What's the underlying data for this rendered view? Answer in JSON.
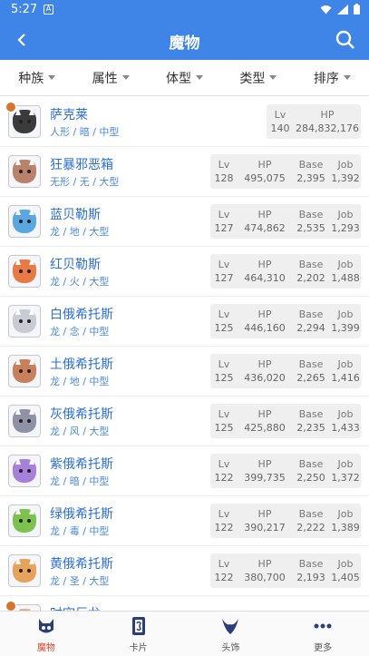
{
  "status": {
    "time": "5:27",
    "notif": "A"
  },
  "header": {
    "title": "魔物"
  },
  "filters": [
    {
      "label": "种族"
    },
    {
      "label": "属性"
    },
    {
      "label": "体型"
    },
    {
      "label": "类型"
    },
    {
      "label": "排序"
    }
  ],
  "stat_labels": {
    "lv": "Lv",
    "hp": "HP",
    "base": "Base",
    "job": "Job"
  },
  "monsters": [
    {
      "name": "萨克莱",
      "meta": "人形 / 暗 / 中型",
      "lv": "140",
      "hp": "284,832,176",
      "base": "",
      "job": "",
      "color": "#3b3b3b"
    },
    {
      "name": "狂暴邪恶箱",
      "meta": "无形 / 无 / 大型",
      "lv": "128",
      "hp": "495,075",
      "base": "2,395",
      "job": "1,392",
      "color": "#b9826a"
    },
    {
      "name": "蓝贝勒斯",
      "meta": "龙 / 地 / 大型",
      "lv": "127",
      "hp": "474,862",
      "base": "2,535",
      "job": "1,293",
      "color": "#5aa6e0"
    },
    {
      "name": "红贝勒斯",
      "meta": "龙 / 火 / 大型",
      "lv": "127",
      "hp": "464,310",
      "base": "2,202",
      "job": "1,488",
      "color": "#e97a45"
    },
    {
      "name": "白俄希托斯",
      "meta": "龙 / 念 / 中型",
      "lv": "125",
      "hp": "446,160",
      "base": "2,294",
      "job": "1,399",
      "color": "#c8cbd3"
    },
    {
      "name": "土俄希托斯",
      "meta": "龙 / 地 / 中型",
      "lv": "125",
      "hp": "436,020",
      "base": "2,265",
      "job": "1,416",
      "color": "#c9805a"
    },
    {
      "name": "灰俄希托斯",
      "meta": "龙 / 风 / 大型",
      "lv": "125",
      "hp": "425,880",
      "base": "2,235",
      "job": "1,433",
      "color": "#8f92a6"
    },
    {
      "name": "紫俄希托斯",
      "meta": "龙 / 暗 / 中型",
      "lv": "122",
      "hp": "399,735",
      "base": "2,250",
      "job": "1,372",
      "color": "#a781d9"
    },
    {
      "name": "绿俄希托斯",
      "meta": "龙 / 毒 / 中型",
      "lv": "122",
      "hp": "390,217",
      "base": "2,222",
      "job": "1,389",
      "color": "#7dc24f"
    },
    {
      "name": "黄俄希托斯",
      "meta": "龙 / 圣 / 大型",
      "lv": "122",
      "hp": "380,700",
      "base": "2,193",
      "job": "1,405",
      "color": "#e8a35a"
    },
    {
      "name": "时空巨龙",
      "meta": "",
      "lv": "",
      "hp": "",
      "base": "",
      "job": "",
      "color": "#e0b08a"
    }
  ],
  "tabs": [
    {
      "label": "魔物",
      "active": true
    },
    {
      "label": "卡片",
      "active": false
    },
    {
      "label": "头饰",
      "active": false
    },
    {
      "label": "更多",
      "active": false
    }
  ],
  "colors": {
    "primary": "#3f85e8",
    "link": "#2c6fd6",
    "active_tab": "#d8462e"
  }
}
